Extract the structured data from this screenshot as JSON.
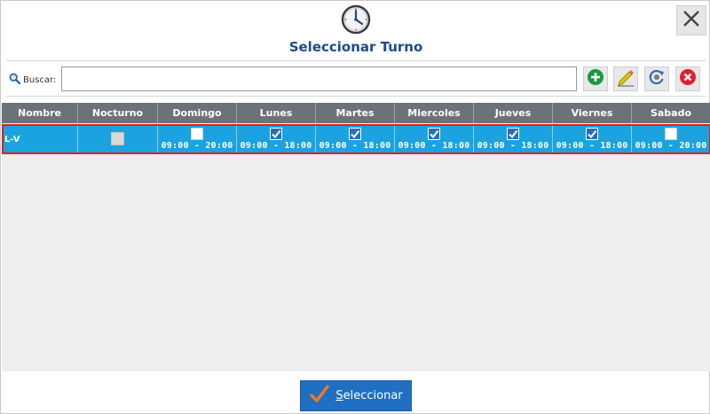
{
  "dialog": {
    "title": "Seleccionar Turno",
    "header_icon": "clock-icon",
    "close_icon": "close-icon"
  },
  "search": {
    "label": "Buscar:",
    "value": "",
    "placeholder": ""
  },
  "toolbar": {
    "buttons": [
      {
        "name": "add",
        "icon": "plus-circle-icon",
        "color": "#1a9a3a"
      },
      {
        "name": "edit",
        "icon": "pencil-icon",
        "color": "#d9b800"
      },
      {
        "name": "refresh",
        "icon": "refresh-icon",
        "color": "#2a6fb8"
      },
      {
        "name": "delete",
        "icon": "x-circle-icon",
        "color": "#e0202f"
      }
    ]
  },
  "grid": {
    "columns": [
      "Nombre",
      "Nocturno",
      "Domingo",
      "Lunes",
      "Martes",
      "Miercoles",
      "Jueves",
      "Viernes",
      "Sabado"
    ],
    "rows": [
      {
        "nombre": "L-V",
        "nocturno": false,
        "days": [
          {
            "checked": false,
            "time": "09:00 - 20:00"
          },
          {
            "checked": true,
            "time": "09:00 - 18:00"
          },
          {
            "checked": true,
            "time": "09:00 - 18:00"
          },
          {
            "checked": true,
            "time": "09:00 - 18:00"
          },
          {
            "checked": true,
            "time": "09:00 - 18:00"
          },
          {
            "checked": true,
            "time": "09:00 - 18:00"
          },
          {
            "checked": false,
            "time": "09:00 - 20:00"
          }
        ]
      }
    ]
  },
  "footer": {
    "select_label": "Seleccionar",
    "select_mnemonic": "S",
    "select_rest": "eleccionar"
  },
  "colors": {
    "title": "#1f4a8c",
    "header_bg": "#6b7278",
    "row_selected": "#1aa3e0",
    "row_outline": "#e02020",
    "primary_button": "#1f6fc2",
    "check_accent": "#f07820"
  }
}
